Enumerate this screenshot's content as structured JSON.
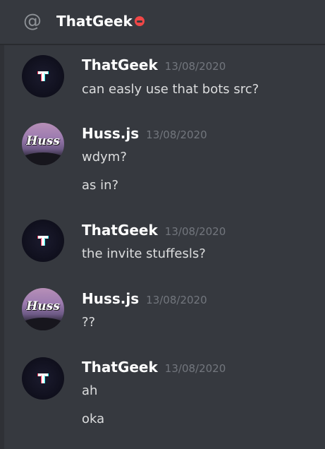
{
  "header": {
    "title": "ThatGeek",
    "at_icon": "@",
    "status_icon": "do-not-disturb-icon",
    "status_color": "#f04747"
  },
  "colors": {
    "background": "#36393f",
    "username": "#ffffff",
    "timestamp": "#72767d",
    "message_text": "#dcddde"
  },
  "avatars": {
    "huss_text": "Huss"
  },
  "messages": [
    {
      "author": "ThatGeek",
      "timestamp": "13/08/2020",
      "avatar": "thatgeek-avatar",
      "lines": [
        "can easly use that bots src?"
      ]
    },
    {
      "author": "Huss.js",
      "timestamp": "13/08/2020",
      "avatar": "huss-avatar",
      "lines": [
        "wdym?",
        "as in?"
      ]
    },
    {
      "author": "ThatGeek",
      "timestamp": "13/08/2020",
      "avatar": "thatgeek-avatar",
      "lines": [
        "the invite stuffesls?"
      ]
    },
    {
      "author": "Huss.js",
      "timestamp": "13/08/2020",
      "avatar": "huss-avatar",
      "lines": [
        "??"
      ]
    },
    {
      "author": "ThatGeek",
      "timestamp": "13/08/2020",
      "avatar": "thatgeek-avatar",
      "lines": [
        "ah",
        "oka"
      ]
    }
  ]
}
